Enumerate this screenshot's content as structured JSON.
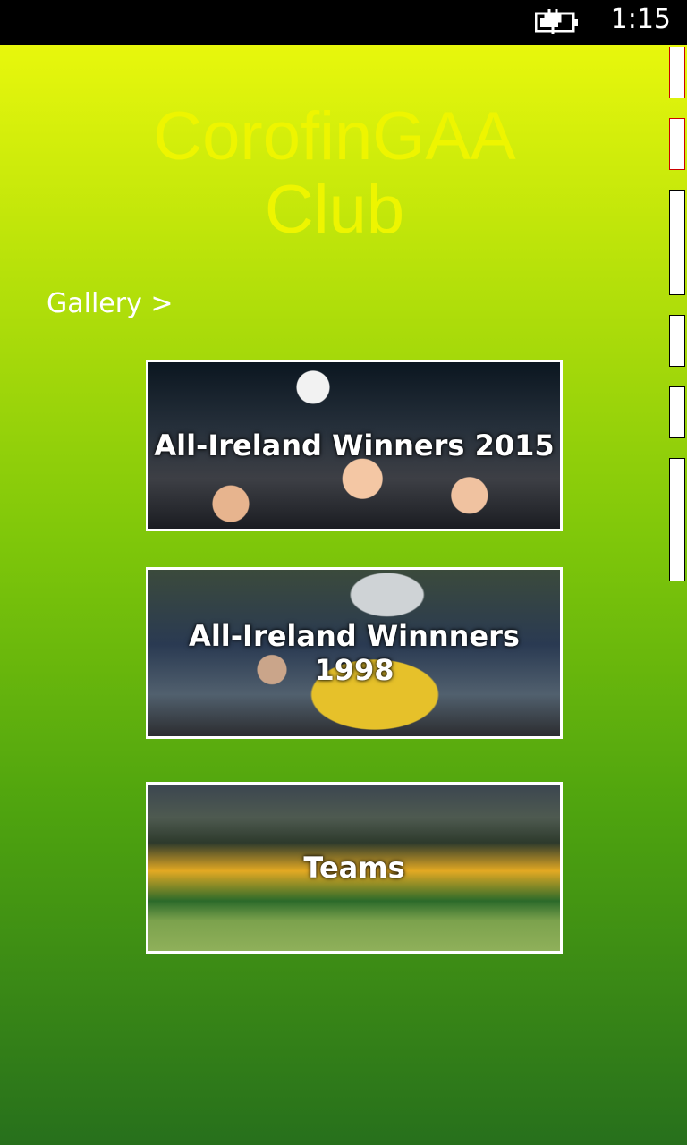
{
  "status_bar": {
    "clock": "1:15",
    "battery_icon": "battery-charging-icon"
  },
  "app": {
    "title_line1": "CorofinGAA",
    "title_line2": "Club",
    "gallery_link": "Gallery >",
    "tiles": [
      {
        "label": "All-Ireland Winners 2015"
      },
      {
        "label": "All-Ireland Winnners 1998"
      },
      {
        "label": "Teams"
      }
    ]
  },
  "colors": {
    "title": "#eef500",
    "gradient_top": "#e8f70c",
    "gradient_bottom": "#27701c"
  }
}
